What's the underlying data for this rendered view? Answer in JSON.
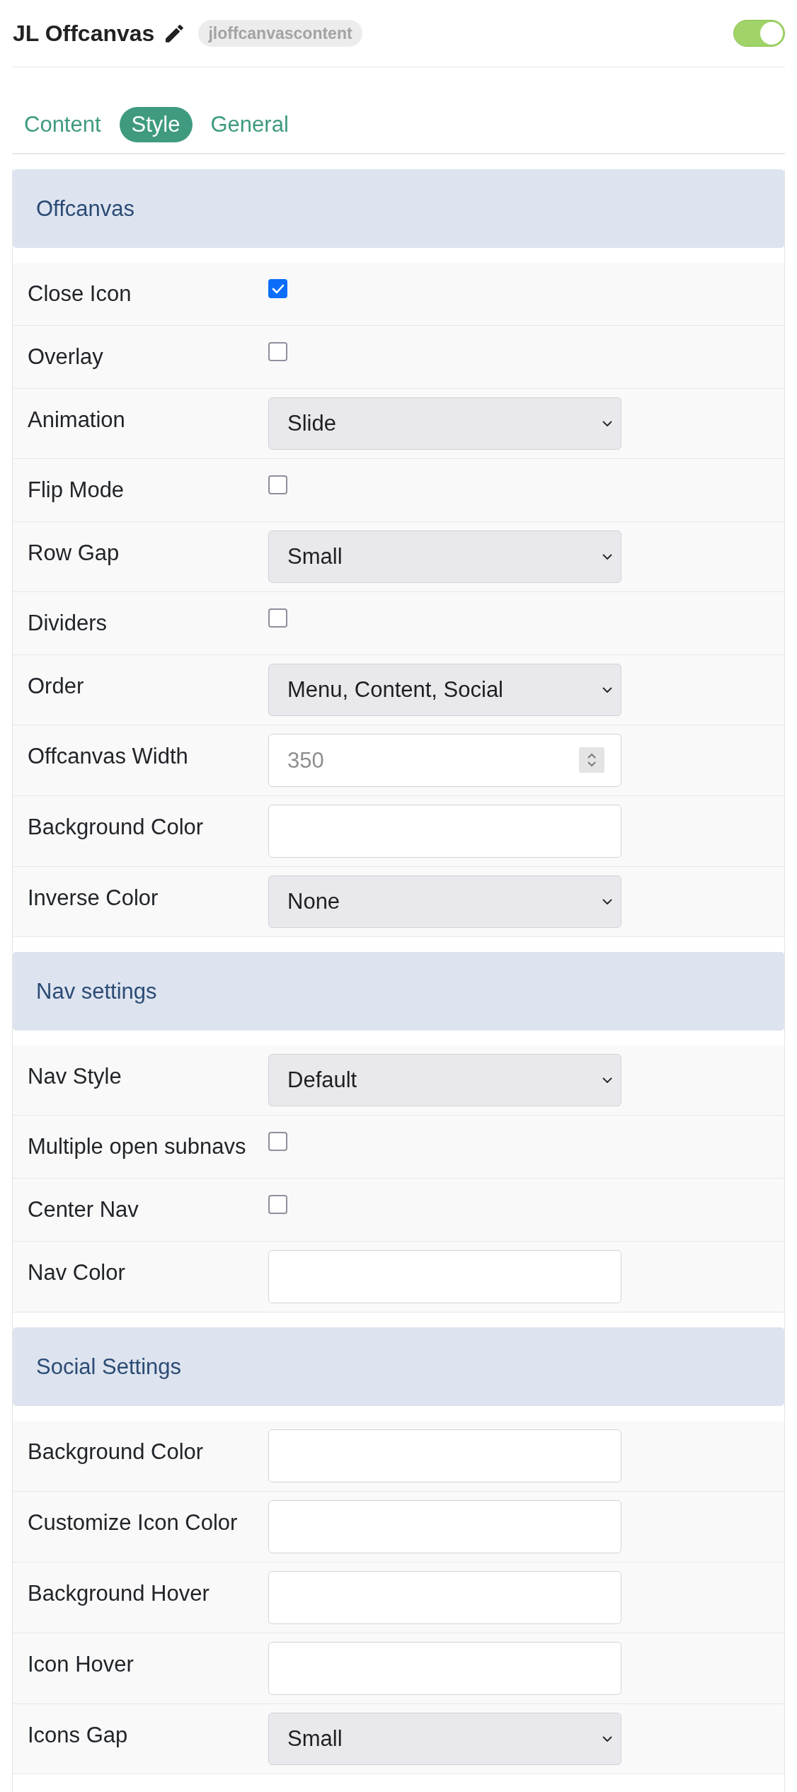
{
  "header": {
    "title": "JL Offcanvas",
    "badge": "jloffcanvascontent",
    "enabled": true
  },
  "tabs": [
    {
      "label": "Content",
      "selected": false
    },
    {
      "label": "Style",
      "selected": true
    },
    {
      "label": "General",
      "selected": false
    }
  ],
  "sections": [
    {
      "title": "Offcanvas",
      "fields": [
        {
          "label": "Close Icon",
          "kind": "checkbox",
          "checked": true
        },
        {
          "label": "Overlay",
          "kind": "checkbox",
          "checked": false
        },
        {
          "label": "Animation",
          "kind": "select",
          "value": "Slide"
        },
        {
          "label": "Flip Mode",
          "kind": "checkbox",
          "checked": false
        },
        {
          "label": "Row Gap",
          "kind": "select",
          "value": "Small"
        },
        {
          "label": "Dividers",
          "kind": "checkbox",
          "checked": false
        },
        {
          "label": "Order",
          "kind": "select",
          "value": "Menu, Content, Social"
        },
        {
          "label": "Offcanvas Width",
          "kind": "number",
          "placeholder": "350"
        },
        {
          "label": "Background Color",
          "kind": "text"
        },
        {
          "label": "Inverse Color",
          "kind": "select",
          "value": "None"
        }
      ]
    },
    {
      "title": "Nav settings",
      "fields": [
        {
          "label": "Nav Style",
          "kind": "select",
          "value": "Default"
        },
        {
          "label": "Multiple open subnavs",
          "kind": "checkbox",
          "checked": false
        },
        {
          "label": "Center Nav",
          "kind": "checkbox",
          "checked": false
        },
        {
          "label": "Nav Color",
          "kind": "text"
        }
      ]
    },
    {
      "title": "Social Settings",
      "fields": [
        {
          "label": "Background Color",
          "kind": "text"
        },
        {
          "label": "Customize Icon Color",
          "kind": "text"
        },
        {
          "label": "Background Hover",
          "kind": "text"
        },
        {
          "label": "Icon Hover",
          "kind": "text"
        },
        {
          "label": "Icons Gap",
          "kind": "select",
          "value": "Small"
        }
      ]
    }
  ]
}
